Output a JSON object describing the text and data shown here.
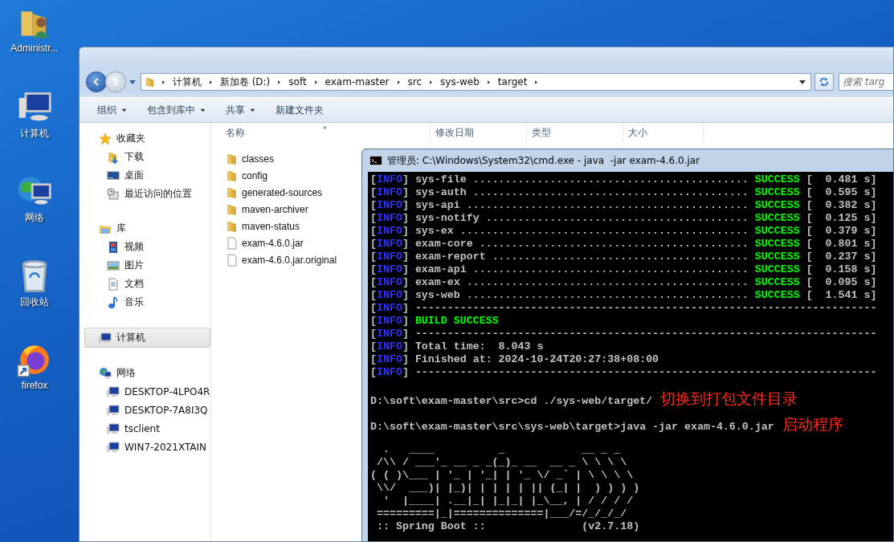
{
  "desktop_icons": [
    {
      "kind": "user-folder",
      "label": "Administr..."
    },
    {
      "kind": "computer",
      "label": "计算机"
    },
    {
      "kind": "network",
      "label": "网络"
    },
    {
      "kind": "recycle-bin",
      "label": "回收站"
    },
    {
      "kind": "browser",
      "label": "firefox"
    }
  ],
  "explorer": {
    "breadcrumb": [
      "计算机",
      "新加卷 (D:)",
      "soft",
      "exam-master",
      "src",
      "sys-web",
      "target"
    ],
    "search": {
      "placeholder": "搜索 targ"
    },
    "toolbar": [
      {
        "label": "组织",
        "dropdown": true
      },
      {
        "label": "包含到库中",
        "dropdown": true
      },
      {
        "label": "共享",
        "dropdown": true
      },
      {
        "label": "新建文件夹",
        "dropdown": false
      }
    ],
    "sidebar": [
      {
        "kind": "favorites",
        "label": "收藏夹",
        "selected": false,
        "children": [
          {
            "kind": "download",
            "label": "下载",
            "selected": false
          },
          {
            "kind": "desktop",
            "label": "桌面",
            "selected": false
          },
          {
            "kind": "recent",
            "label": "最近访问的位置",
            "selected": false
          }
        ]
      },
      {
        "kind": "library",
        "label": "库",
        "selected": false,
        "children": [
          {
            "kind": "video",
            "label": "视频",
            "selected": false
          },
          {
            "kind": "picture",
            "label": "图片",
            "selected": false
          },
          {
            "kind": "document",
            "label": "文档",
            "selected": false
          },
          {
            "kind": "music",
            "label": "音乐",
            "selected": false
          }
        ]
      },
      {
        "kind": "computer",
        "label": "计算机",
        "selected": true
      },
      {
        "kind": "network",
        "label": "网络",
        "selected": false,
        "children": [
          {
            "kind": "computer",
            "label": "DESKTOP-4LPO4R",
            "selected": false
          },
          {
            "kind": "computer",
            "label": "DESKTOP-7A8I3Q",
            "selected": false
          },
          {
            "kind": "computer",
            "label": "tsclient",
            "selected": false
          },
          {
            "kind": "computer",
            "label": "WIN7-2021XTAIN",
            "selected": false
          }
        ]
      }
    ],
    "columns": [
      "名称",
      "修改日期",
      "类型",
      "大小"
    ],
    "files": [
      {
        "kind": "folder",
        "name": "classes"
      },
      {
        "kind": "folder",
        "name": "config"
      },
      {
        "kind": "folder",
        "name": "generated-sources"
      },
      {
        "kind": "folder",
        "name": "maven-archiver"
      },
      {
        "kind": "folder",
        "name": "maven-status"
      },
      {
        "kind": "file",
        "name": "exam-4.6.0.jar"
      },
      {
        "kind": "file",
        "name": "exam-4.6.0.jar.original"
      }
    ]
  },
  "console": {
    "title": "管理员: C:\\Windows\\System32\\cmd.exe - java  -jar exam-4.6.0.jar",
    "lines": [
      {
        "kind": "module",
        "tag": "[INFO]",
        "label": "sys-file ...........................................",
        "status": "SUCCESS",
        "time": "[  0.481 s]"
      },
      {
        "kind": "module",
        "tag": "[INFO]",
        "label": "sys-auth ...........................................",
        "status": "SUCCESS",
        "time": "[  0.595 s]"
      },
      {
        "kind": "module",
        "tag": "[INFO]",
        "label": "sys-api ............................................",
        "status": "SUCCESS",
        "time": "[  0.382 s]"
      },
      {
        "kind": "module",
        "tag": "[INFO]",
        "label": "sys-notify .........................................",
        "status": "SUCCESS",
        "time": "[  0.125 s]"
      },
      {
        "kind": "module",
        "tag": "[INFO]",
        "label": "sys-ex .............................................",
        "status": "SUCCESS",
        "time": "[  0.379 s]"
      },
      {
        "kind": "module",
        "tag": "[INFO]",
        "label": "exam-core ..........................................",
        "status": "SUCCESS",
        "time": "[  0.801 s]"
      },
      {
        "kind": "module",
        "tag": "[INFO]",
        "label": "exam-report ........................................",
        "status": "SUCCESS",
        "time": "[  0.237 s]"
      },
      {
        "kind": "module",
        "tag": "[INFO]",
        "label": "exam-api ...........................................",
        "status": "SUCCESS",
        "time": "[  0.158 s]"
      },
      {
        "kind": "module",
        "tag": "[INFO]",
        "label": "exam-ex ............................................",
        "status": "SUCCESS",
        "time": "[  0.095 s]"
      },
      {
        "kind": "module",
        "tag": "[INFO]",
        "label": "sys-web ............................................",
        "status": "SUCCESS",
        "time": "[  1.541 s]"
      },
      {
        "kind": "separator",
        "tag": "[INFO]",
        "text": "------------------------------------------------------------------------"
      },
      {
        "kind": "result",
        "tag": "[INFO]",
        "text": "BUILD SUCCESS"
      },
      {
        "kind": "separator",
        "tag": "[INFO]",
        "text": "------------------------------------------------------------------------"
      },
      {
        "kind": "info",
        "tag": "[INFO]",
        "text": "Total time:  8.043 s"
      },
      {
        "kind": "info",
        "tag": "[INFO]",
        "text": "Finished at: 2024-10-24T20:27:38+08:00"
      },
      {
        "kind": "separator",
        "tag": "[INFO]",
        "text": "------------------------------------------------------------------------"
      },
      {
        "kind": "blank"
      },
      {
        "kind": "prompt",
        "text": "D:\\soft\\exam-master\\src>cd ./sys-web/target/",
        "note": "切换到打包文件目录"
      },
      {
        "kind": "blank"
      },
      {
        "kind": "prompt",
        "text": "D:\\soft\\exam-master\\src\\sys-web\\target>java -jar exam-4.6.0.jar",
        "note": "启动程序"
      },
      {
        "kind": "blank"
      },
      {
        "kind": "banner",
        "text": "  .   ____          _            __ _ _"
      },
      {
        "kind": "banner",
        "text": " /\\\\ / ___'_ __ _ _(_)_ __  __ _ \\ \\ \\ \\"
      },
      {
        "kind": "banner",
        "text": "( ( )\\___ | '_ | '_| | '_ \\/ _` | \\ \\ \\ \\"
      },
      {
        "kind": "banner",
        "text": " \\\\/  ___)| |_)| | | | | || (_| |  ) ) ) )"
      },
      {
        "kind": "banner",
        "text": "  '  |____| .__|_| |_|_| |_\\__, | / / / /"
      },
      {
        "kind": "banner",
        "text": " =========|_|==============|___/=/_/_/_/"
      },
      {
        "kind": "banner",
        "text": " :: Spring Boot ::               (v2.7.18)"
      }
    ]
  }
}
